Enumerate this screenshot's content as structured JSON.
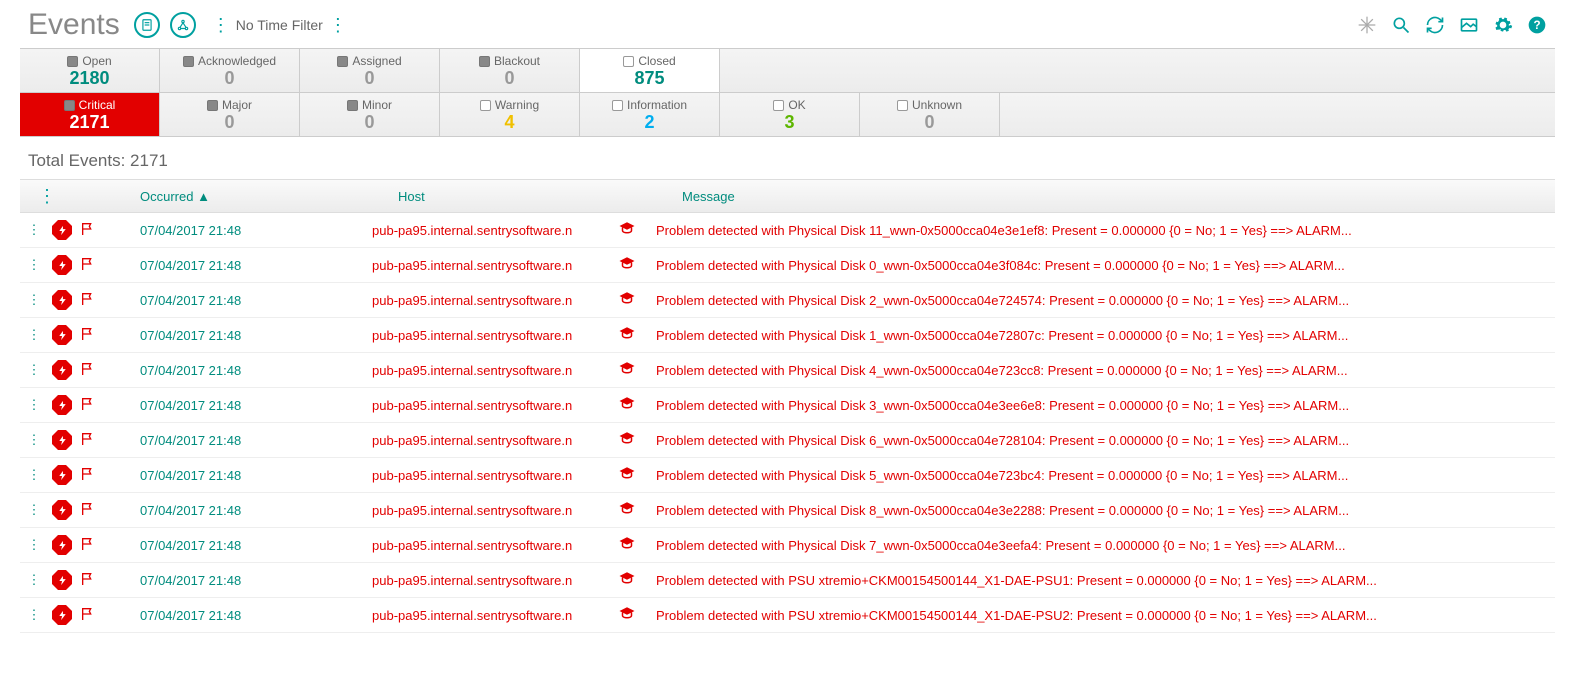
{
  "title": "Events",
  "time_filter_label": "No Time Filter",
  "colors": {
    "accent": "#008c7e",
    "critical": "#e20000"
  },
  "status_tabs": [
    {
      "label": "Open",
      "count": "2180",
      "checked": true,
      "num_class": "c-teal",
      "closed": false
    },
    {
      "label": "Acknowledged",
      "count": "0",
      "checked": true,
      "num_class": "c-gray",
      "closed": false
    },
    {
      "label": "Assigned",
      "count": "0",
      "checked": true,
      "num_class": "c-gray",
      "closed": false
    },
    {
      "label": "Blackout",
      "count": "0",
      "checked": true,
      "num_class": "c-gray",
      "closed": false
    },
    {
      "label": "Closed",
      "count": "875",
      "checked": false,
      "num_class": "c-teal",
      "closed": true
    }
  ],
  "severity_tabs": [
    {
      "label": "Critical",
      "count": "2171",
      "checked": true,
      "active": true,
      "num_class": ""
    },
    {
      "label": "Major",
      "count": "0",
      "checked": true,
      "num_class": "c-gray"
    },
    {
      "label": "Minor",
      "count": "0",
      "checked": true,
      "num_class": "c-gray"
    },
    {
      "label": "Warning",
      "count": "4",
      "checked": false,
      "num_class": "c-yellow"
    },
    {
      "label": "Information",
      "count": "2",
      "checked": false,
      "num_class": "c-blue"
    },
    {
      "label": "OK",
      "count": "3",
      "checked": false,
      "num_class": "c-green"
    },
    {
      "label": "Unknown",
      "count": "0",
      "checked": false,
      "num_class": "c-gray"
    }
  ],
  "total_label": "Total Events: 2171",
  "columns": {
    "occurred": "Occurred ▲",
    "host": "Host",
    "message": "Message"
  },
  "events": [
    {
      "occurred": "07/04/2017 21:48",
      "host": "pub-pa95.internal.sentrysoftware.n",
      "message": "Problem detected with Physical Disk 11_wwn-0x5000cca04e3e1ef8: Present = 0.000000 {0 = No; 1 = Yes} ==> ALARM..."
    },
    {
      "occurred": "07/04/2017 21:48",
      "host": "pub-pa95.internal.sentrysoftware.n",
      "message": "Problem detected with Physical Disk 0_wwn-0x5000cca04e3f084c: Present = 0.000000 {0 = No; 1 = Yes} ==> ALARM..."
    },
    {
      "occurred": "07/04/2017 21:48",
      "host": "pub-pa95.internal.sentrysoftware.n",
      "message": "Problem detected with Physical Disk 2_wwn-0x5000cca04e724574: Present = 0.000000 {0 = No; 1 = Yes} ==> ALARM..."
    },
    {
      "occurred": "07/04/2017 21:48",
      "host": "pub-pa95.internal.sentrysoftware.n",
      "message": "Problem detected with Physical Disk 1_wwn-0x5000cca04e72807c: Present = 0.000000 {0 = No; 1 = Yes} ==> ALARM..."
    },
    {
      "occurred": "07/04/2017 21:48",
      "host": "pub-pa95.internal.sentrysoftware.n",
      "message": "Problem detected with Physical Disk 4_wwn-0x5000cca04e723cc8: Present = 0.000000 {0 = No; 1 = Yes} ==> ALARM..."
    },
    {
      "occurred": "07/04/2017 21:48",
      "host": "pub-pa95.internal.sentrysoftware.n",
      "message": "Problem detected with Physical Disk 3_wwn-0x5000cca04e3ee6e8: Present = 0.000000 {0 = No; 1 = Yes} ==> ALARM..."
    },
    {
      "occurred": "07/04/2017 21:48",
      "host": "pub-pa95.internal.sentrysoftware.n",
      "message": "Problem detected with Physical Disk 6_wwn-0x5000cca04e728104: Present = 0.000000 {0 = No; 1 = Yes} ==> ALARM..."
    },
    {
      "occurred": "07/04/2017 21:48",
      "host": "pub-pa95.internal.sentrysoftware.n",
      "message": "Problem detected with Physical Disk 5_wwn-0x5000cca04e723bc4: Present = 0.000000 {0 = No; 1 = Yes} ==> ALARM..."
    },
    {
      "occurred": "07/04/2017 21:48",
      "host": "pub-pa95.internal.sentrysoftware.n",
      "message": "Problem detected with Physical Disk 8_wwn-0x5000cca04e3e2288: Present = 0.000000 {0 = No; 1 = Yes} ==> ALARM..."
    },
    {
      "occurred": "07/04/2017 21:48",
      "host": "pub-pa95.internal.sentrysoftware.n",
      "message": "Problem detected with Physical Disk 7_wwn-0x5000cca04e3eefa4: Present = 0.000000 {0 = No; 1 = Yes} ==> ALARM..."
    },
    {
      "occurred": "07/04/2017 21:48",
      "host": "pub-pa95.internal.sentrysoftware.n",
      "message": "Problem detected with PSU xtremio+CKM00154500144_X1-DAE-PSU1: Present = 0.000000 {0 = No; 1 = Yes} ==> ALARM..."
    },
    {
      "occurred": "07/04/2017 21:48",
      "host": "pub-pa95.internal.sentrysoftware.n",
      "message": "Problem detected with PSU xtremio+CKM00154500144_X1-DAE-PSU2: Present = 0.000000 {0 = No; 1 = Yes} ==> ALARM..."
    }
  ]
}
